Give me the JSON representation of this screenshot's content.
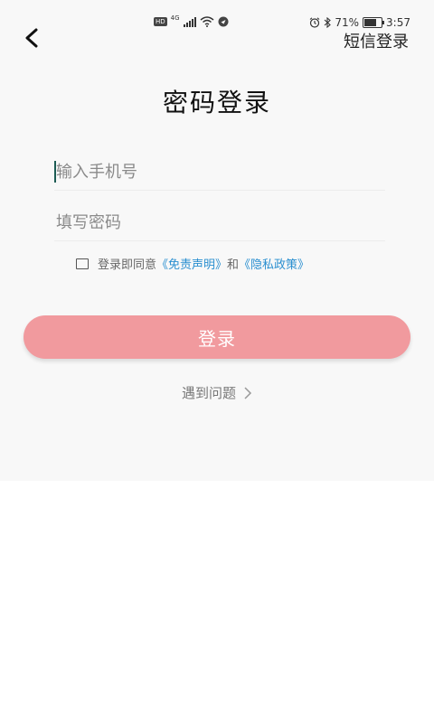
{
  "status_bar": {
    "hd": "HD",
    "network": "4G",
    "battery_percent": "71%",
    "battery_level": 0.71,
    "time": "3:57"
  },
  "header": {
    "sms_login": "短信登录"
  },
  "title": "密码登录",
  "form": {
    "phone_placeholder": "输入手机号",
    "password_placeholder": "填写密码"
  },
  "agreement": {
    "prefix": "登录即同意",
    "disclaimer_link": "《免责声明》",
    "and": "和",
    "privacy_link": "《隐私政策》"
  },
  "login_button": "登录",
  "help_link": "遇到问题",
  "colors": {
    "primary_button": "#f19a9e",
    "link": "#2a8fd0",
    "background": "#f8f8f8"
  }
}
